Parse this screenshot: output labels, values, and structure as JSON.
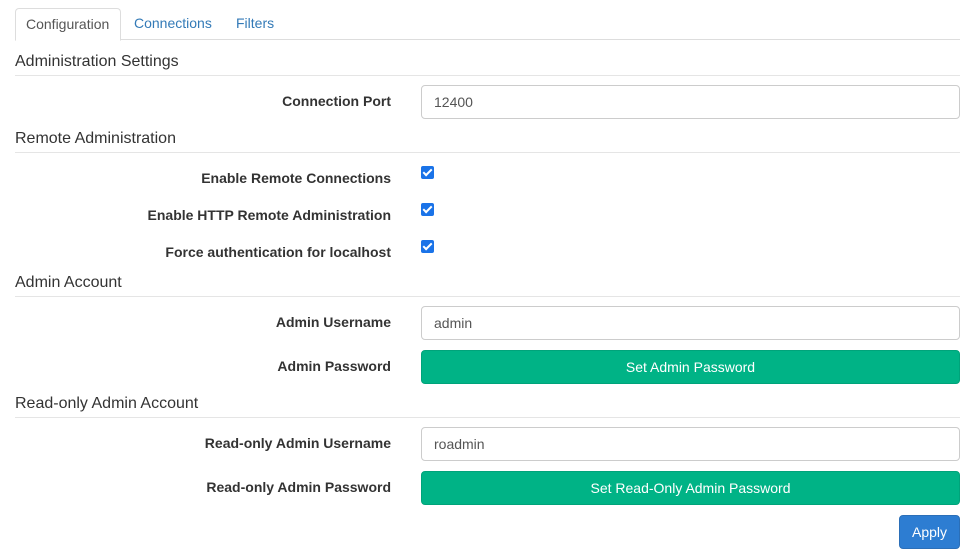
{
  "tabs": [
    {
      "label": "Configuration",
      "active": true
    },
    {
      "label": "Connections",
      "active": false
    },
    {
      "label": "Filters",
      "active": false
    }
  ],
  "administration_settings": {
    "title": "Administration Settings",
    "connection_port_label": "Connection Port",
    "connection_port_value": "12400"
  },
  "remote_administration": {
    "title": "Remote Administration",
    "enable_remote_label": "Enable Remote Connections",
    "enable_remote_checked": true,
    "enable_http_label": "Enable HTTP Remote Administration",
    "enable_http_checked": true,
    "force_auth_label": "Force authentication for localhost",
    "force_auth_checked": true
  },
  "admin_account": {
    "title": "Admin Account",
    "username_label": "Admin Username",
    "username_value": "admin",
    "password_label": "Admin Password",
    "password_button": "Set Admin Password"
  },
  "readonly_admin_account": {
    "title": "Read-only Admin Account",
    "username_label": "Read-only Admin Username",
    "username_value": "roadmin",
    "password_label": "Read-only Admin Password",
    "password_button": "Set Read-Only Admin Password"
  },
  "apply_label": "Apply",
  "colors": {
    "link": "#337ab7",
    "green_button": "#00b386",
    "apply_button": "#2d7dd2",
    "checkbox": "#1a73e8"
  }
}
